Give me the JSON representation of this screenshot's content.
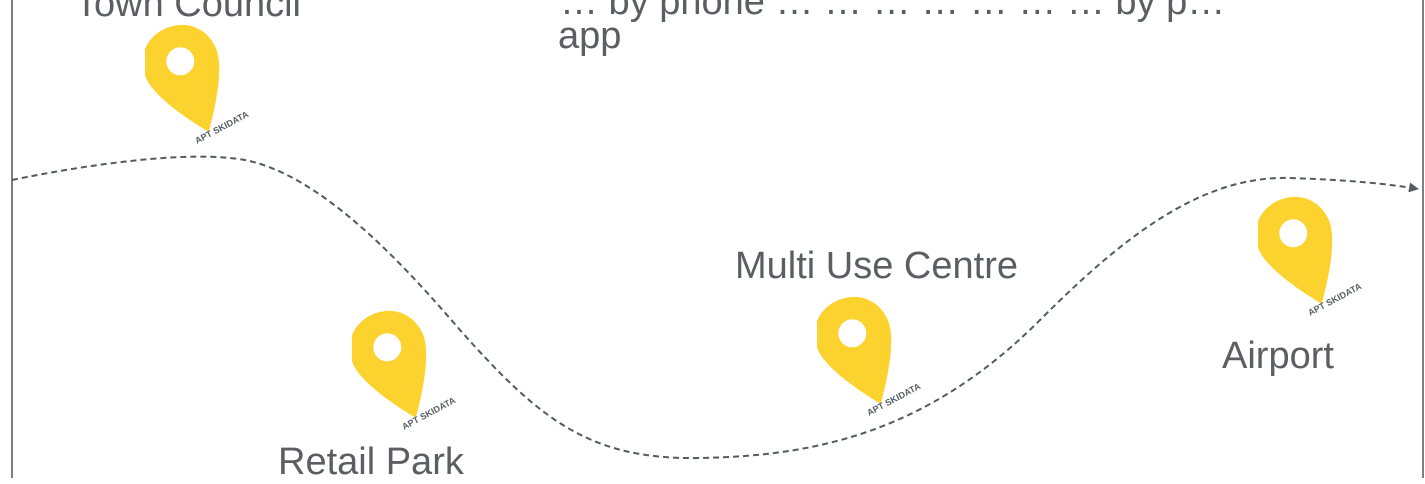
{
  "heading": {
    "line1": "… by phone … … … … … … … by p…",
    "line2": "app"
  },
  "locations": [
    {
      "name": "Town Council",
      "icon": "location-pin-icon",
      "badge": "APT SKIDATA"
    },
    {
      "name": "Retail Park",
      "icon": "location-pin-icon",
      "badge": "APT SKIDATA"
    },
    {
      "name": "Multi Use Centre",
      "icon": "location-pin-icon",
      "badge": "APT SKIDATA"
    },
    {
      "name": "Airport",
      "icon": "location-pin-icon",
      "badge": "APT SKIDATA"
    }
  ],
  "colors": {
    "pin": "#fcd22f",
    "pin_hole": "#ffffff",
    "text": "#5b5f63",
    "route": "#555a5e",
    "frame": "#7f7f7f"
  }
}
